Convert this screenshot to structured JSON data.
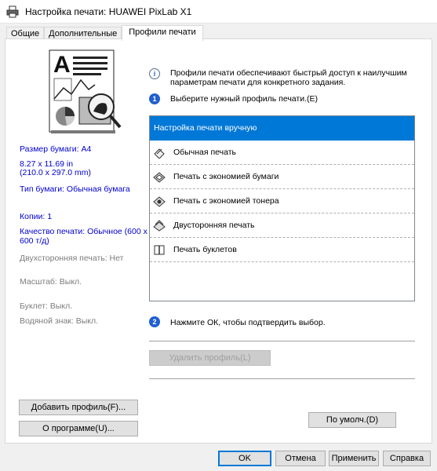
{
  "window": {
    "title": "Настройка печати: HUAWEI PixLab X1"
  },
  "tabs": [
    {
      "label": "Общие"
    },
    {
      "label": "Дополнительные"
    },
    {
      "label": "Профили печати"
    }
  ],
  "left_info": {
    "paper_size": "Размер бумаги: A4",
    "paper_dims_in": "8.27 x 11.69 in",
    "paper_dims_mm": "(210.0 x 297.0 mm)",
    "paper_type": "Тип бумаги: Обычная бумага",
    "copies": "Копии: 1",
    "quality_line1": "Качество печати: Обычное (600 x",
    "quality_line2": "600 т/д)",
    "duplex": "Двухсторонняя печать: Нет",
    "scale": "Масштаб: Выкл.",
    "booklet": "Буклет: Выкл.",
    "watermark": "Водяной знак: Выкл."
  },
  "hints": {
    "intro_line1": "Профили печати обеспечивают быстрый доступ к наилучшим",
    "intro_line2": "параметрам печати для конкретного задания.",
    "step1_badge": "1",
    "step1": "Выберите нужный профиль печати.(E)",
    "step2_badge": "2",
    "step2": "Нажмите ОК, чтобы подтвердить выбор."
  },
  "profiles": [
    {
      "label": "Настройка печати вручную",
      "icon": "none",
      "selected": true
    },
    {
      "label": "Обычная печать",
      "icon": "printer-pen-icon",
      "selected": false
    },
    {
      "label": "Печать с экономией бумаги",
      "icon": "paper-save-icon",
      "selected": false
    },
    {
      "label": "Печать с экономией тонера",
      "icon": "toner-save-icon",
      "selected": false
    },
    {
      "label": "Двусторонняя печать",
      "icon": "duplex-icon",
      "selected": false
    },
    {
      "label": "Печать буклетов",
      "icon": "booklet-icon",
      "selected": false
    }
  ],
  "buttons": {
    "delete_profile": "Удалить профиль(L)",
    "add_profile": "Добавить профиль(F)...",
    "about": "О программе(U)...",
    "defaults": "По умолч.(D)",
    "ok": "OK",
    "cancel": "Отмена",
    "apply": "Применить",
    "help": "Справка"
  },
  "colors": {
    "selection": "#0078d7",
    "info_text": "#0000d0",
    "disabled_text": "#7c7c7c"
  }
}
